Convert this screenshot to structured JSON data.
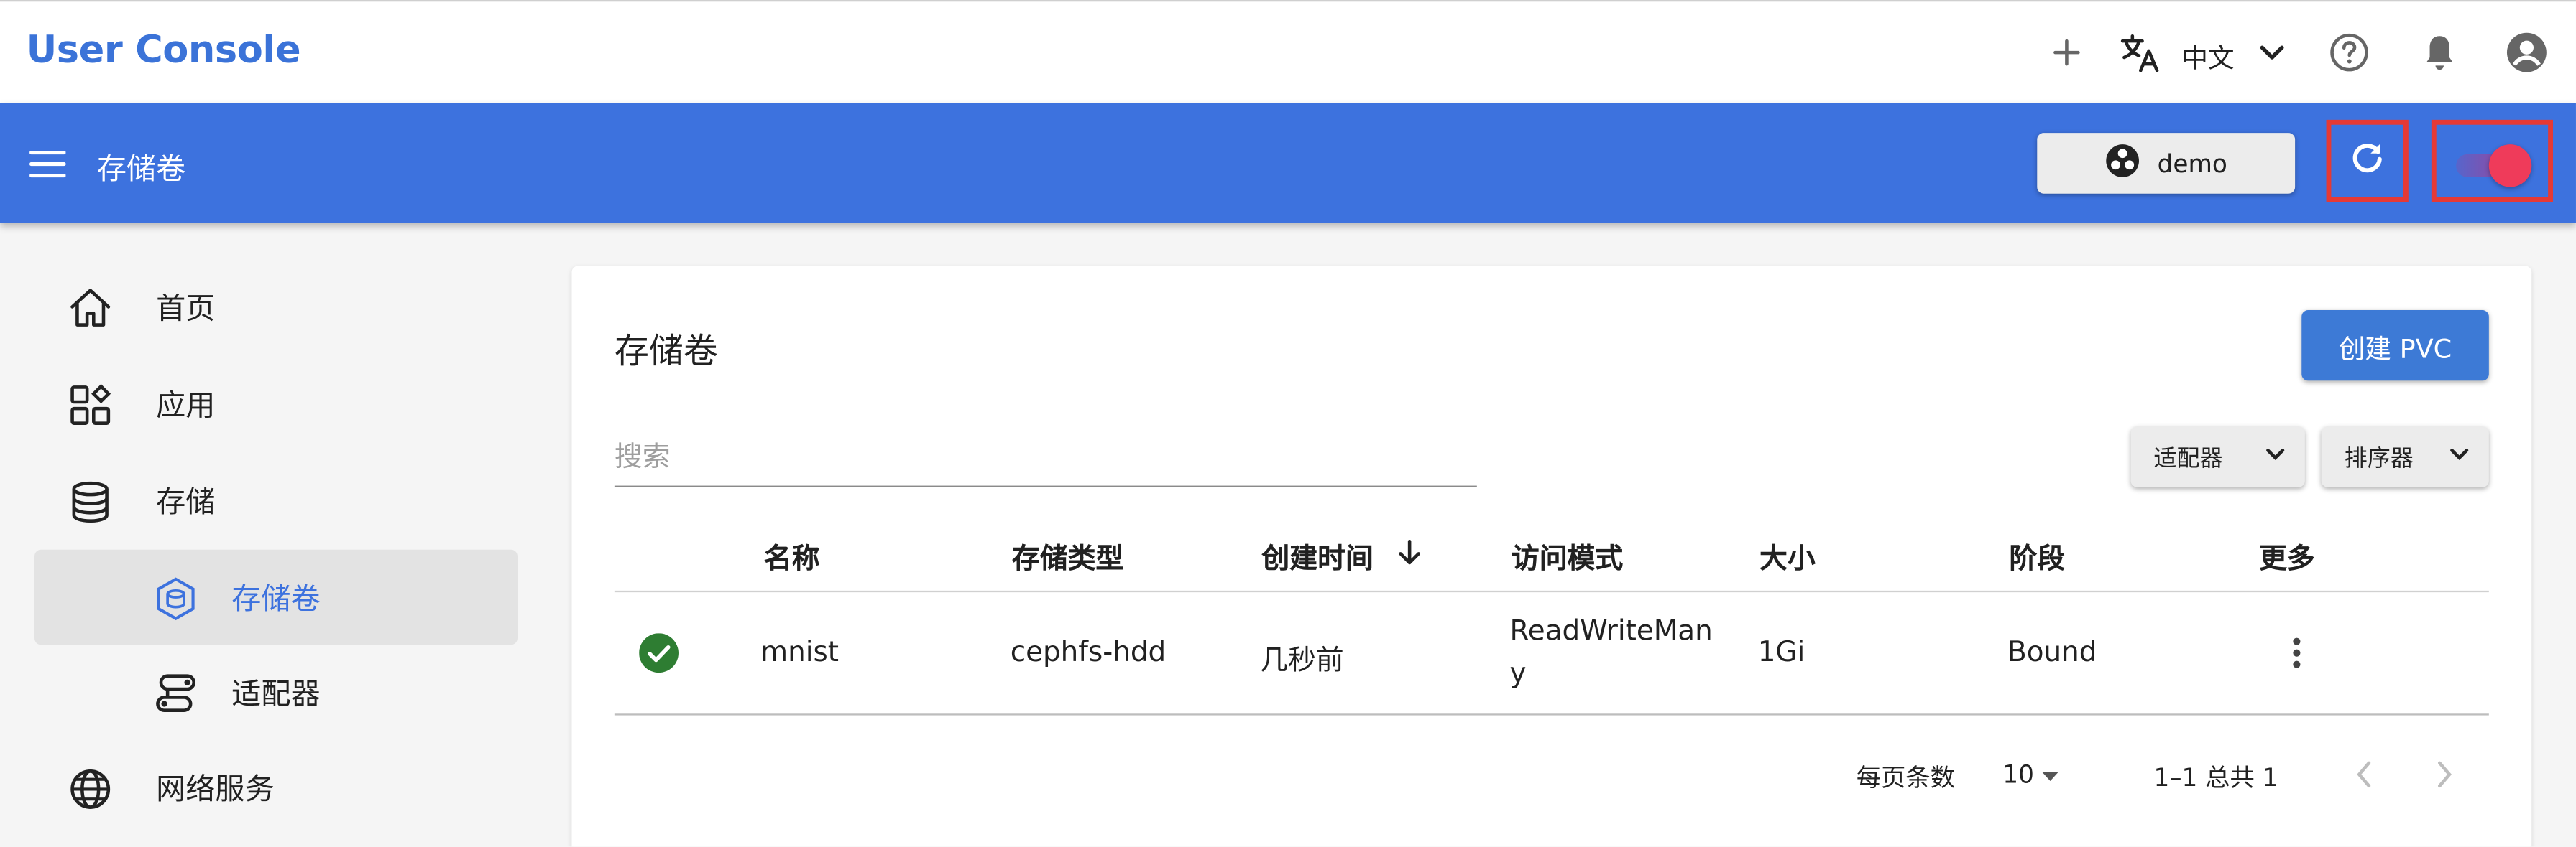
{
  "header": {
    "app_title": "User Console",
    "language": "中文",
    "icons": [
      "plus-icon",
      "translate-icon",
      "chevron-down-icon",
      "help-icon",
      "bell-icon",
      "account-icon"
    ]
  },
  "appbar": {
    "title": "存储卷",
    "namespace": "demo"
  },
  "sidebar": {
    "items": [
      {
        "label": "首页",
        "icon": "home-icon"
      },
      {
        "label": "应用",
        "icon": "apps-icon"
      },
      {
        "label": "存储",
        "icon": "database-icon"
      },
      {
        "label": "存储卷",
        "icon": "volume-icon",
        "active": true
      },
      {
        "label": "适配器",
        "icon": "adapter-icon"
      },
      {
        "label": "网络服务",
        "icon": "globe-icon"
      }
    ]
  },
  "main": {
    "title": "存储卷",
    "create_label": "创建 PVC",
    "search_placeholder": "搜索",
    "filter_label": "适配器",
    "sort_label": "排序器",
    "columns": [
      "名称",
      "存储类型",
      "创建时间",
      "访问模式",
      "大小",
      "阶段",
      "更多"
    ],
    "rows": [
      {
        "status": "ok",
        "name": "mnist",
        "storage_class": "cephfs-hdd",
        "created": "几秒前",
        "access_mode_line1": "ReadWriteMan",
        "access_mode_line2": "y",
        "size": "1Gi",
        "phase": "Bound"
      }
    ],
    "pagination": {
      "rows_per_page_label": "每页条数",
      "rows_per_page": "10",
      "range": "1–1 总共 1"
    }
  },
  "colors": {
    "brand": "#3d72de",
    "status_ok": "#2e7d32",
    "highlight": "#e53935",
    "toggle": "#ef3b5a"
  }
}
